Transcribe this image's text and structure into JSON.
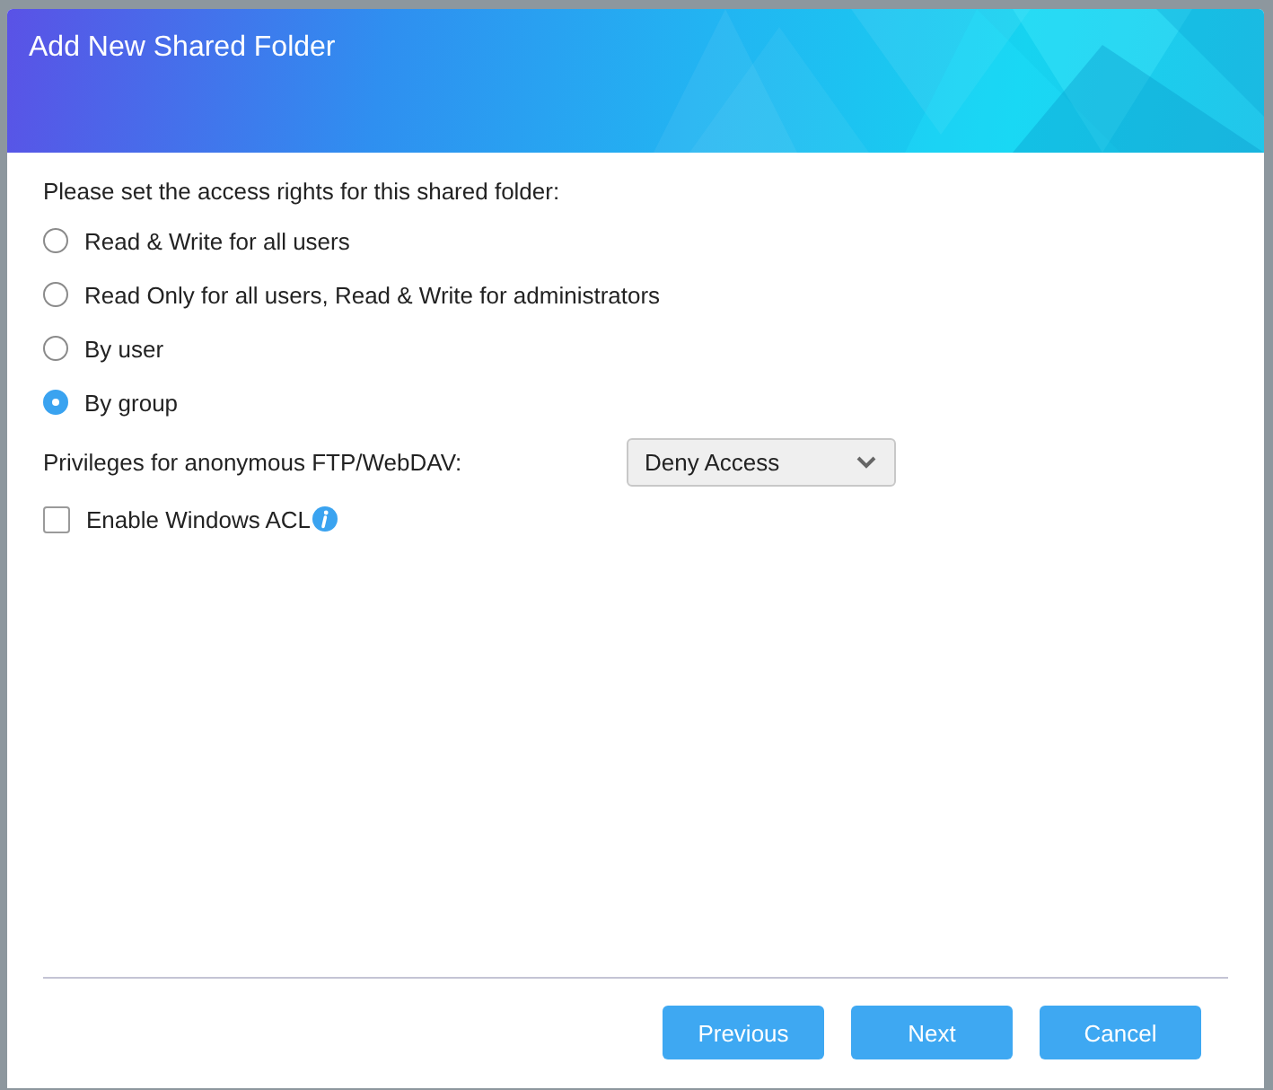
{
  "dialog": {
    "title": "Add New Shared Folder"
  },
  "access_rights": {
    "prompt": "Please set the access rights for this shared folder:",
    "options": [
      {
        "label": "Read & Write for all users",
        "selected": false
      },
      {
        "label": "Read Only for all users, Read & Write for administrators",
        "selected": false
      },
      {
        "label": "By user",
        "selected": false
      },
      {
        "label": "By group",
        "selected": true
      }
    ]
  },
  "anonymous_privileges": {
    "label": "Privileges for anonymous FTP/WebDAV:",
    "value": "Deny Access"
  },
  "windows_acl": {
    "label": "Enable Windows ACL",
    "checked": false
  },
  "buttons": [
    "Previous",
    "Next",
    "Cancel"
  ]
}
